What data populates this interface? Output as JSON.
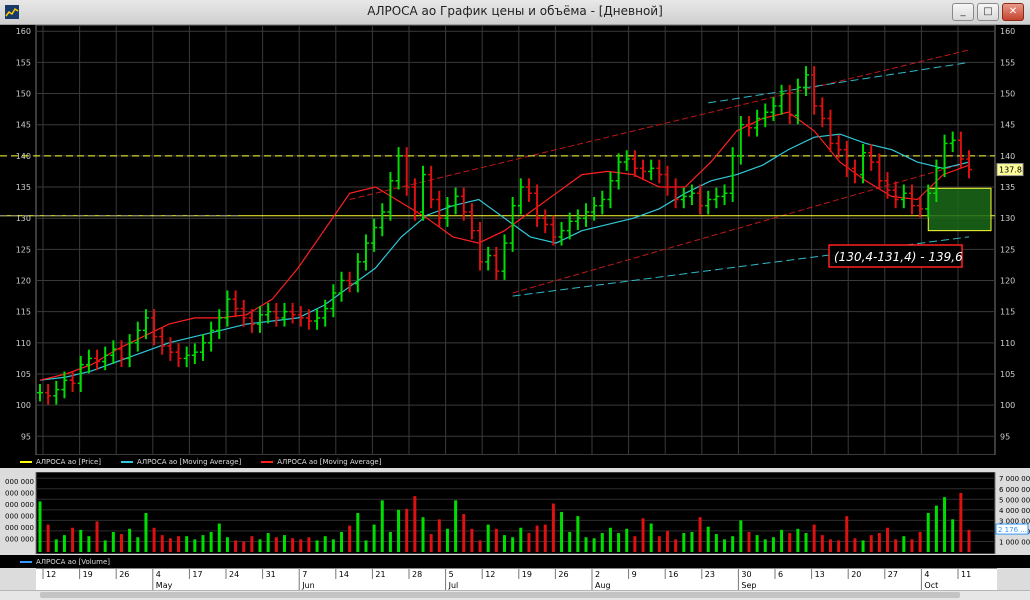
{
  "window": {
    "title": "АЛРОСА ао График цены и объёма - [Дневной]",
    "btn_min": "_",
    "btn_max": "□",
    "btn_close": "✕"
  },
  "price_chart": {
    "y_ticks": [
      "160",
      "155",
      "150",
      "145",
      "140",
      "135",
      "130",
      "125",
      "120",
      "115",
      "110",
      "105",
      "100",
      "95"
    ],
    "last_price_label": "137.8",
    "annotation": "(130,4-131,4) - 139,6",
    "support_levels": [
      140,
      130.4
    ],
    "legend": [
      "АЛРОСА ао [Price]",
      "АЛРОСА ао [Moving Average]",
      "АЛРОСА ао [Moving Average]"
    ]
  },
  "volume_chart": {
    "y_ticks": [
      "7 000 000",
      "6 000 000",
      "5 000 000",
      "4 000 000",
      "3 000 000",
      "2 000 000",
      "1 000 000"
    ],
    "left_ticks": [
      "000 000",
      "000 000",
      "000 000",
      "000 000",
      "000 000",
      "000 000"
    ],
    "legend": "АЛРОСА ао [Volume]",
    "last_label": "2 176 ..."
  },
  "date_axis": {
    "days": [
      "12",
      "19",
      "26",
      "4",
      "17",
      "24",
      "31",
      "7",
      "14",
      "21",
      "28",
      "5",
      "12",
      "19",
      "26",
      "2",
      "9",
      "16",
      "23",
      "30",
      "6",
      "13",
      "20",
      "27",
      "4",
      "11"
    ],
    "months": [
      "May",
      "Jun",
      "Jul",
      "Aug",
      "Sep",
      "Oct"
    ]
  },
  "colors": {
    "up": "#00dd00",
    "down": "#dd1111",
    "ma_fast": "#ff2020",
    "ma_slow": "#30c8d8",
    "level": "#ffff33",
    "grid": "#3a3a3a",
    "legend_price": "#ffff00",
    "legend_ma1": "#30c8d8",
    "legend_ma2": "#ff2020",
    "legend_vol": "#3399ff"
  },
  "chart_data": {
    "type": "candlestick",
    "title": "АЛРОСА ао График цены и объёма - [Дневной]",
    "xlabel": "",
    "ylabel": "",
    "ylim": [
      92,
      161
    ],
    "x": [
      "May",
      "Jun",
      "Jul",
      "Aug",
      "Sep",
      "Oct"
    ],
    "series": [
      {
        "name": "АЛРОСА ао [Price]",
        "values": [
          102,
          101.5,
          102.5,
          104,
          103.5,
          106.5,
          107.5,
          107,
          108,
          109,
          107.5,
          110,
          112,
          114,
          111,
          109.5,
          108.5,
          107.5,
          108,
          108.5,
          110,
          112,
          114,
          117,
          115.5,
          114,
          113,
          114.5,
          115,
          114,
          115,
          114.5,
          114,
          113.5,
          114,
          115.5,
          118,
          120,
          119.5,
          123,
          126,
          128.5,
          131,
          136,
          140,
          135,
          131,
          137,
          133,
          130,
          132,
          133.5,
          131,
          128,
          123,
          124,
          121.5,
          126,
          132,
          135,
          134,
          130,
          129,
          127,
          128,
          129.5,
          130,
          131,
          132,
          133,
          136,
          139,
          139.5,
          138,
          137.5,
          138,
          137,
          135,
          133,
          133.5,
          134,
          132,
          133,
          133.5,
          134,
          140,
          145,
          144.5,
          146,
          147,
          148,
          150,
          146.5,
          151,
          153,
          148,
          146,
          142,
          141,
          138,
          137,
          140.5,
          139,
          136,
          134.5,
          133,
          134,
          132,
          131.5,
          134,
          138,
          142,
          142.5,
          139.5,
          137.8
        ]
      },
      {
        "name": "АЛРОСА ао [Moving Average]",
        "values": [
          104,
          104.5,
          105.5,
          107,
          108.5,
          110,
          111,
          112,
          113,
          113.5,
          114,
          116,
          119,
          122,
          127,
          130.5,
          132,
          133,
          130,
          127,
          126,
          128,
          129,
          130,
          131.5,
          134,
          136,
          137,
          138.5,
          141,
          143,
          143.5,
          142,
          141,
          139,
          138,
          139
        ]
      },
      {
        "name": "АЛРОСА ао [Moving Average]",
        "values": [
          104,
          105,
          106.5,
          109,
          111,
          113,
          114,
          114,
          114.5,
          117,
          122,
          128,
          134,
          135,
          132.5,
          130,
          127,
          126,
          128,
          131,
          134,
          137,
          137.5,
          137,
          135,
          135,
          139,
          144,
          146,
          147,
          144,
          139,
          136,
          133.5,
          133,
          137,
          138.5
        ]
      },
      {
        "name": "АЛРОСА ао [Volume]",
        "values": [
          4800000,
          2600000,
          1200000,
          1600000,
          2300000,
          2100000,
          1500000,
          2900000,
          1100000,
          1900000,
          1700000,
          2200000,
          1400000,
          3700000,
          2300000,
          1600000,
          1300000,
          1500000,
          1500000,
          1200000,
          1600000,
          1900000,
          2700000,
          1400000,
          1100000,
          1000000,
          1500000,
          1200000,
          1800000,
          1400000,
          1600000,
          1300000,
          1200000,
          1400000,
          1100000,
          1500000,
          1200000,
          1900000,
          2500000,
          3700000,
          1100000,
          2600000,
          4900000,
          1900000,
          4000000,
          4100000,
          5300000,
          3300000,
          1700000,
          3100000,
          2200000,
          4900000,
          3600000,
          2200000,
          1100000,
          2600000,
          2200000,
          1600000,
          1400000,
          2300000,
          1800000,
          2500000,
          2600000,
          4600000,
          3800000,
          1900000,
          3400000,
          1400000,
          1300000,
          1800000,
          2300000,
          1800000,
          2200000,
          1500000,
          3200000,
          2700000,
          1500000,
          2000000,
          1200000,
          1800000,
          1900000,
          3300000,
          2400000,
          1700000,
          1200000,
          1500000,
          3000000,
          1900000,
          1600000,
          1200000,
          1400000,
          2100000,
          1800000,
          2200000,
          1800000,
          2600000,
          1600000,
          1200000,
          1100000,
          3400000,
          1300000,
          1100000,
          1600000,
          1800000,
          2300000,
          1200000,
          1500000,
          1200000,
          1900000,
          3700000,
          4400000,
          5200000,
          3100000,
          5600000,
          2100000
        ]
      }
    ]
  }
}
